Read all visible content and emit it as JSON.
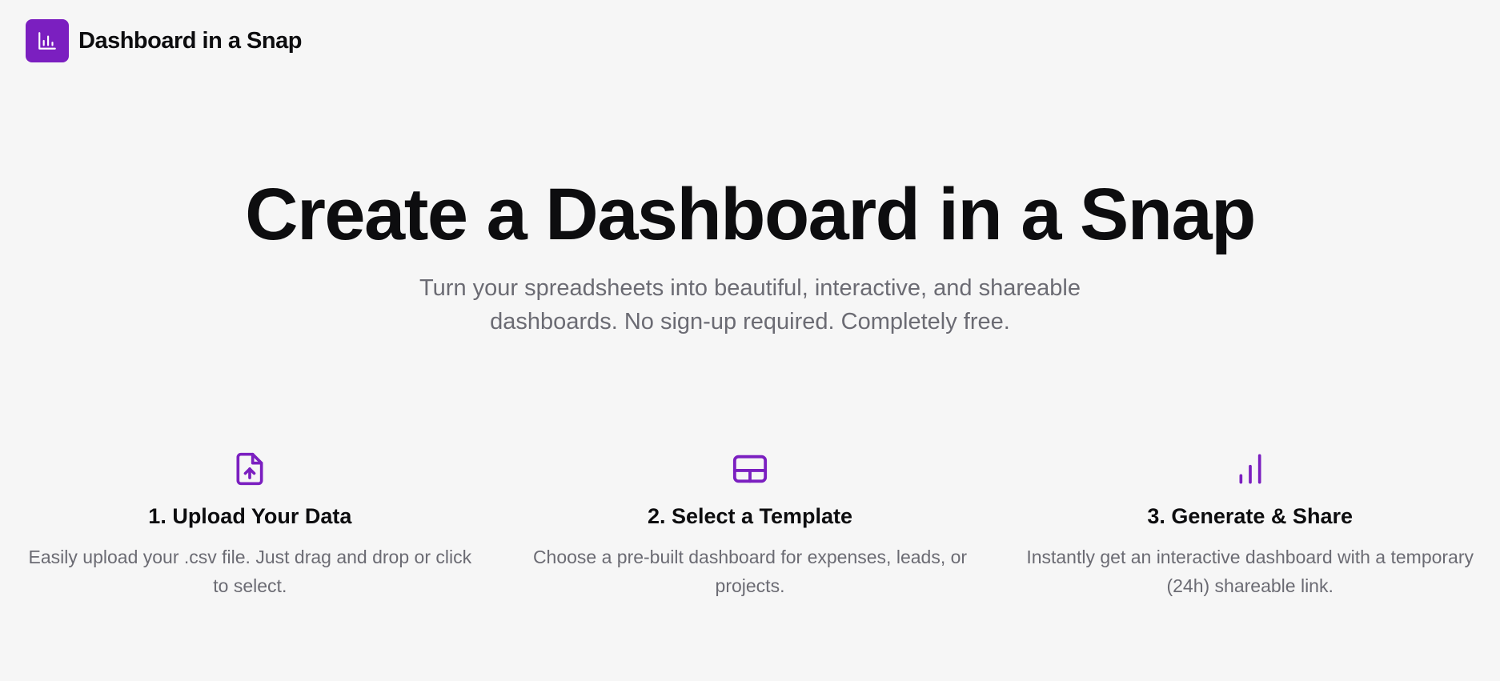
{
  "header": {
    "brand_name": "Dashboard in a Snap",
    "logo_icon": "bar-chart-icon"
  },
  "hero": {
    "title": "Create a Dashboard in a Snap",
    "subtitle": "Turn your spreadsheets into beautiful, interactive, and shareable dashboards. No sign-up required. Completely free."
  },
  "features": [
    {
      "icon": "file-upload-icon",
      "title": "1. Upload Your Data",
      "description": "Easily upload your .csv file. Just drag and drop or click to select."
    },
    {
      "icon": "template-layout-icon",
      "title": "2. Select a Template",
      "description": "Choose a pre-built dashboard for expenses, leads, or projects."
    },
    {
      "icon": "bar-chart-icon",
      "title": "3. Generate & Share",
      "description": "Instantly get an interactive dashboard with a temporary (24h) shareable link."
    }
  ],
  "colors": {
    "accent": "#7b1fc0",
    "background": "#f6f6f6",
    "heading": "#0d0d0f",
    "muted_text": "#6b6b73"
  }
}
